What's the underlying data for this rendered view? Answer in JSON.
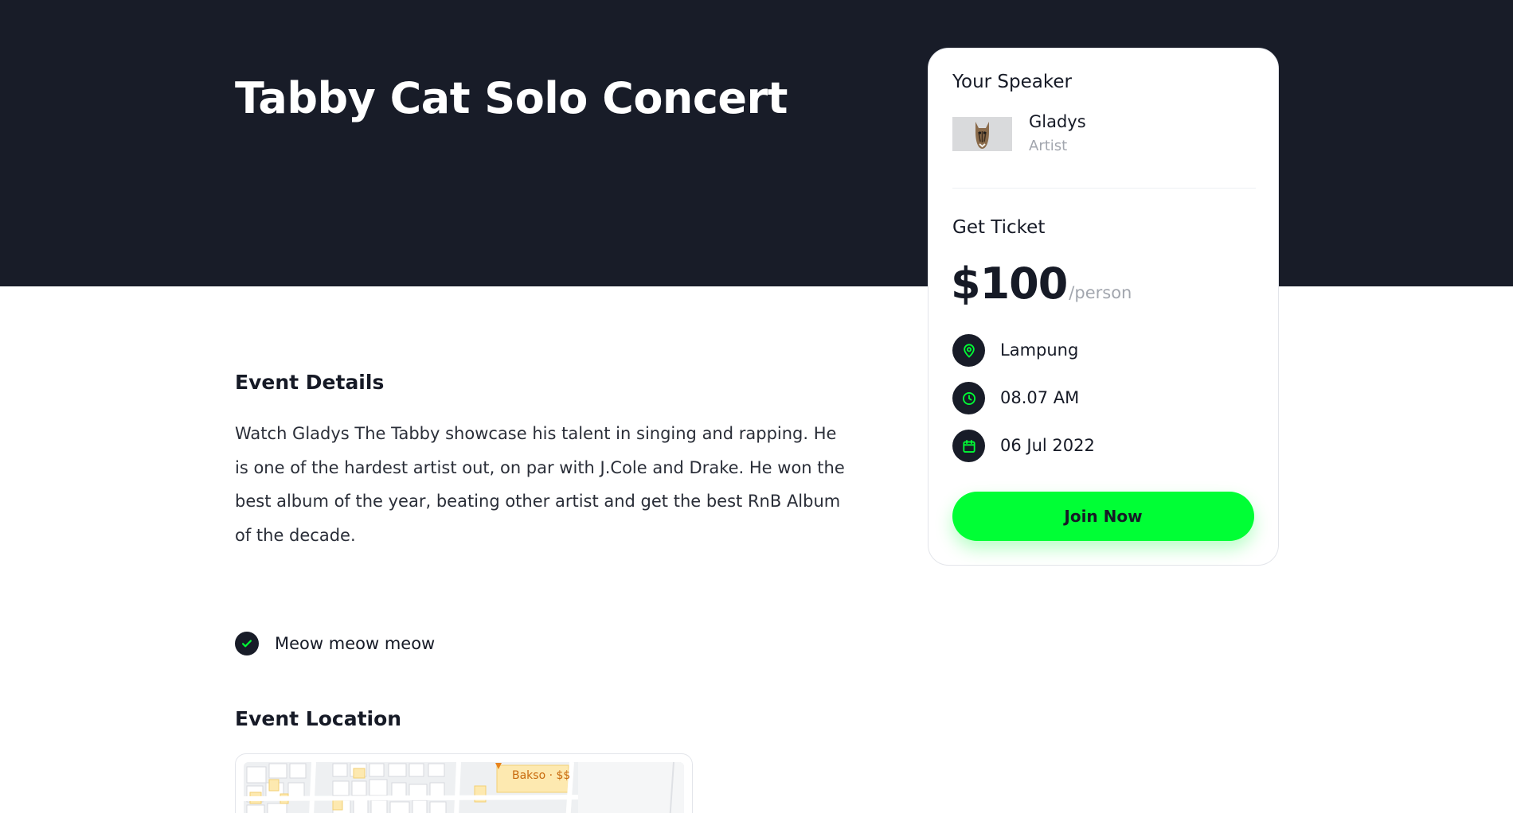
{
  "event": {
    "title": "Tabby Cat Solo Concert"
  },
  "speaker_card": {
    "heading": "Your Speaker",
    "speaker": {
      "name": "Gladys",
      "role": "Artist"
    },
    "ticket_heading": "Get Ticket",
    "price": "$100",
    "price_unit": "/person",
    "location": "Lampung",
    "time": "08.07 AM",
    "date": "06 Jul 2022",
    "join_label": "Join Now"
  },
  "details": {
    "heading": "Event Details",
    "description": "Watch Gladys The Tabby showcase his talent in singing and rapping. He is one of the hardest artist out, on par with J.Cole and Drake. He won the best album of the year, beating other artist and get the best RnB Album of the decade.",
    "highlights": [
      "Meow meow meow"
    ]
  },
  "location": {
    "heading": "Event Location",
    "map_place_label": "Bakso · $$"
  },
  "colors": {
    "dark": "#181c28",
    "accent": "#00ff35",
    "muted": "#a2a6ae"
  },
  "icons": {
    "location": "map-pin-icon",
    "time": "clock-icon",
    "date": "calendar-icon",
    "highlight": "check-icon"
  }
}
